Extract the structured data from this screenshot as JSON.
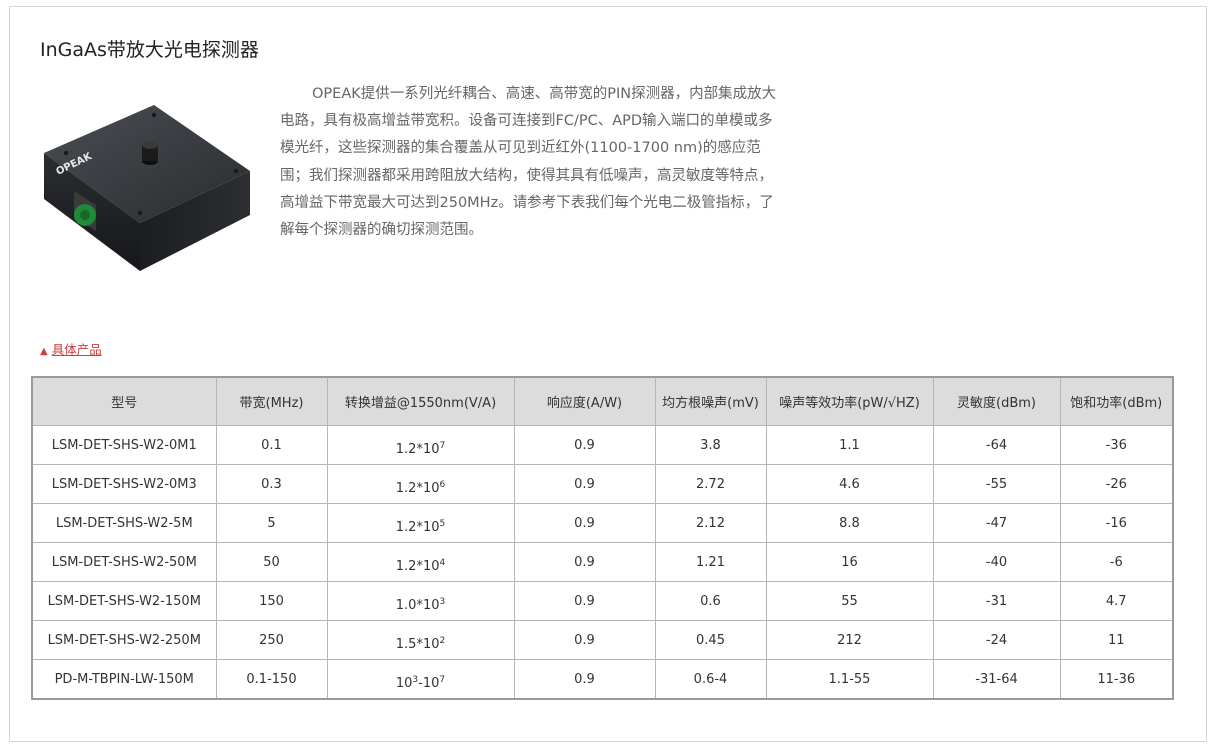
{
  "page": {
    "title": "InGaAs带放大光电探测器",
    "intro": "OPEAK提供一系列光纤耦合、高速、高带宽的PIN探测器，内部集成放大电路，具有极高增益带宽积。设备可连接到FC/PC、APD输入端口的单模或多模光纤，这些探测器的集合覆盖从可见到近红外(1100-1700 nm)的感应范围；我们探测器都采用跨阻放大结构，使得其具有低噪声，高灵敏度等特点，高增益下带宽最大可达到250MHz。请参考下表我们每个光电二极管指标，了解每个探测器的确切探测范围。",
    "product_logo_text": "OPEAK",
    "section_link": "具体产品",
    "section_link_icon": "triangle-up-icon"
  },
  "colors": {
    "link": "#d03d3d",
    "header_bg": "#dcdcdc",
    "border": "#9a9a9a"
  },
  "table": {
    "headers": [
      "型号",
      "带宽(MHz)",
      "转换增益@1550nm(V/A)",
      "响应度(A/W)",
      "均方根噪声(mV)",
      "噪声等效功率(pW/√HZ)",
      "灵敏度(dBm)",
      "饱和功率(dBm)"
    ],
    "rows": [
      {
        "model": "LSM-DET-SHS-W2-0M1",
        "bandwidth": "0.1",
        "gain_base": "1.2*10",
        "gain_exp": "7",
        "gain_sep": "",
        "gain_base2": "",
        "gain_exp2": "",
        "responsivity": "0.9",
        "noise": "3.8",
        "nep": "1.1",
        "sensitivity": "-64",
        "saturation": "-36"
      },
      {
        "model": "LSM-DET-SHS-W2-0M3",
        "bandwidth": "0.3",
        "gain_base": "1.2*10",
        "gain_exp": "6",
        "gain_sep": "",
        "gain_base2": "",
        "gain_exp2": "",
        "responsivity": "0.9",
        "noise": "2.72",
        "nep": "4.6",
        "sensitivity": "-55",
        "saturation": "-26"
      },
      {
        "model": "LSM-DET-SHS-W2-5M",
        "bandwidth": "5",
        "gain_base": "1.2*10",
        "gain_exp": "5",
        "gain_sep": "",
        "gain_base2": "",
        "gain_exp2": "",
        "responsivity": "0.9",
        "noise": "2.12",
        "nep": "8.8",
        "sensitivity": "-47",
        "saturation": "-16"
      },
      {
        "model": "LSM-DET-SHS-W2-50M",
        "bandwidth": "50",
        "gain_base": "1.2*10",
        "gain_exp": "4",
        "gain_sep": "",
        "gain_base2": "",
        "gain_exp2": "",
        "responsivity": "0.9",
        "noise": "1.21",
        "nep": "16",
        "sensitivity": "-40",
        "saturation": "-6"
      },
      {
        "model": "LSM-DET-SHS-W2-150M",
        "bandwidth": "150",
        "gain_base": "1.0*10",
        "gain_exp": "3",
        "gain_sep": "",
        "gain_base2": "",
        "gain_exp2": "",
        "responsivity": "0.9",
        "noise": "0.6",
        "nep": "55",
        "sensitivity": "-31",
        "saturation": "4.7"
      },
      {
        "model": "LSM-DET-SHS-W2-250M",
        "bandwidth": "250",
        "gain_base": "1.5*10",
        "gain_exp": "2",
        "gain_sep": "",
        "gain_base2": "",
        "gain_exp2": "",
        "responsivity": "0.9",
        "noise": "0.45",
        "nep": "212",
        "sensitivity": "-24",
        "saturation": "11"
      },
      {
        "model": "PD-M-TBPIN-LW-150M",
        "bandwidth": "0.1-150",
        "gain_base": "10",
        "gain_exp": "3",
        "gain_sep": "-",
        "gain_base2": "10",
        "gain_exp2": "7",
        "responsivity": "0.9",
        "noise": "0.6-4",
        "nep": "1.1-55",
        "sensitivity": "-31-64",
        "saturation": "11-36"
      }
    ]
  }
}
